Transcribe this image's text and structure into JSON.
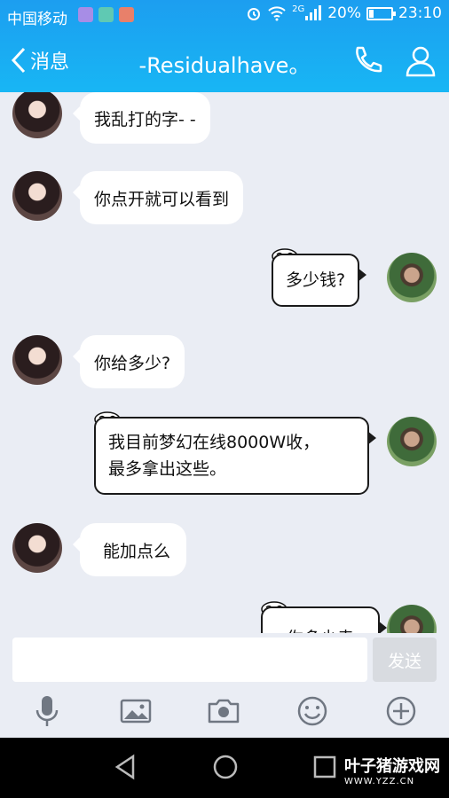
{
  "status_bar": {
    "carrier": "中国移动",
    "network": "2G",
    "battery": "20%",
    "time": "23:10"
  },
  "header": {
    "back_label": "消息",
    "title": "-Residualhave。"
  },
  "messages": [
    {
      "side": "in",
      "text": "我乱打的字- -"
    },
    {
      "side": "in",
      "text": "你点开就可以看到"
    },
    {
      "side": "out",
      "text": "多少钱?"
    },
    {
      "side": "in",
      "text": "你给多少?"
    },
    {
      "side": "out",
      "line1": "我目前梦幻在线8000W收，",
      "line2": "最多拿出这些。"
    },
    {
      "side": "in",
      "text": "能加点么"
    },
    {
      "side": "out",
      "text": "你多少卖"
    }
  ],
  "input": {
    "send_label": "发送"
  },
  "watermark": {
    "brand": "叶子猪游戏网",
    "url": "WWW.YZZ.CN"
  },
  "colors": {
    "header": "#1c9ef0",
    "chat_background": "#eaedf4"
  }
}
